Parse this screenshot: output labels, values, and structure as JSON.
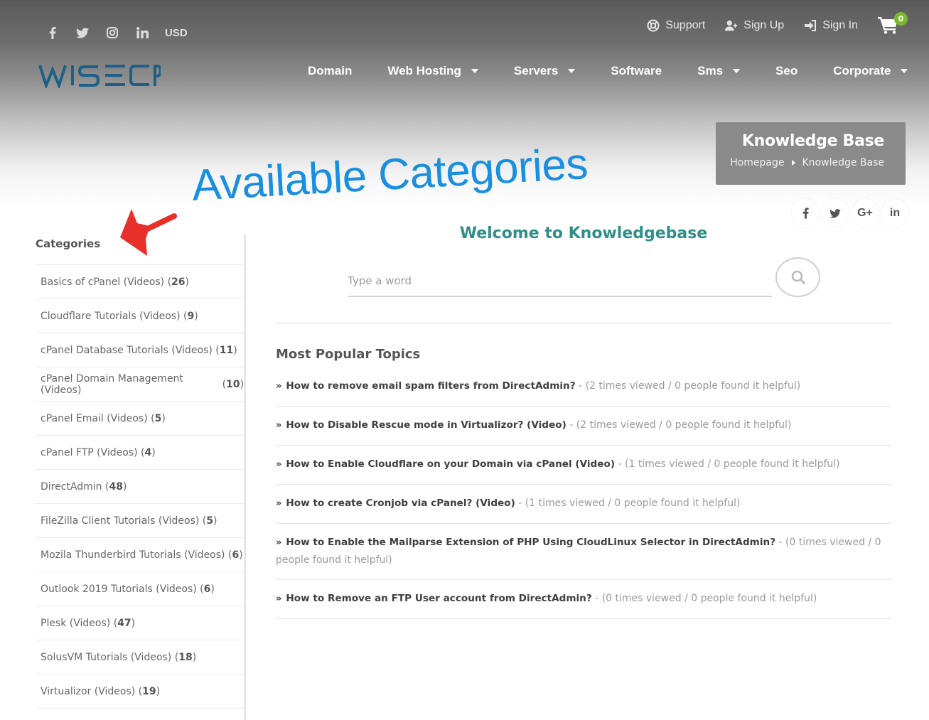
{
  "top": {
    "social_icons": [
      "facebook-icon",
      "twitter-icon",
      "instagram-icon",
      "linkedin-icon"
    ],
    "currency": "USD",
    "user_links": [
      {
        "label": "Support",
        "icon": "lifebuoy-icon"
      },
      {
        "label": "Sign Up",
        "icon": "user-plus-icon"
      },
      {
        "label": "Sign In",
        "icon": "sign-in-icon"
      }
    ],
    "cart_count": "0"
  },
  "logo_text": "WISECP",
  "nav": [
    {
      "label": "Domain",
      "dropdown": false
    },
    {
      "label": "Web Hosting",
      "dropdown": true
    },
    {
      "label": "Servers",
      "dropdown": true
    },
    {
      "label": "Software",
      "dropdown": false
    },
    {
      "label": "Sms",
      "dropdown": true
    },
    {
      "label": "Seo",
      "dropdown": false
    },
    {
      "label": "Corporate",
      "dropdown": true
    }
  ],
  "page_header": {
    "title": "Knowledge Base",
    "breadcrumb": [
      "Homepage",
      "Knowledge Base"
    ]
  },
  "annotation": "Available Categories",
  "share": [
    "f",
    "twitter",
    "G+",
    "in"
  ],
  "sidebar": {
    "heading": "Categories",
    "categories": [
      {
        "name": "Basics of cPanel (Videos)",
        "count": "26"
      },
      {
        "name": "Cloudflare Tutorials (Videos)",
        "count": "9"
      },
      {
        "name": "cPanel Database Tutorials (Videos)",
        "count": "11"
      },
      {
        "name": "cPanel Domain Management (Videos)",
        "count": "10"
      },
      {
        "name": "cPanel Email (Videos)",
        "count": "5"
      },
      {
        "name": "cPanel FTP (Videos)",
        "count": "4"
      },
      {
        "name": "DirectAdmin",
        "count": "48"
      },
      {
        "name": "FileZilla Client Tutorials (Videos)",
        "count": "5"
      },
      {
        "name": "Mozila Thunderbird Tutorials (Videos)",
        "count": "6"
      },
      {
        "name": "Outlook 2019 Tutorials (Videos)",
        "count": "6"
      },
      {
        "name": "Plesk (Videos)",
        "count": "47"
      },
      {
        "name": "SolusVM Tutorials (Videos)",
        "count": "18"
      },
      {
        "name": "Virtualizor (Videos)",
        "count": "19"
      }
    ]
  },
  "main": {
    "welcome": "Welcome to Knowledgebase",
    "search_placeholder": "Type a word",
    "popular_heading": "Most Popular Topics",
    "topics": [
      {
        "title": "How to remove email spam filters from DirectAdmin?",
        "meta": "- (2 times viewed / 0 people found it helpful)"
      },
      {
        "title": "How to Disable Rescue mode in Virtualizor? (Video)",
        "meta": "- (2 times viewed / 0 people found it helpful)"
      },
      {
        "title": "How to Enable Cloudflare on your Domain via cPanel (Video)",
        "meta": "- (1 times viewed / 0 people found it helpful)"
      },
      {
        "title": "How to create Cronjob via cPanel? (Video)",
        "meta": "- (1 times viewed / 0 people found it helpful)"
      },
      {
        "title": "How to Enable the Mailparse Extension of PHP Using CloudLinux Selector in DirectAdmin?",
        "meta": "- (0 times viewed / 0 people found it helpful)"
      },
      {
        "title": "How to Remove an FTP User account from DirectAdmin?",
        "meta": "- (0 times viewed / 0 people found it helpful)"
      }
    ]
  },
  "colors": {
    "accent_teal": "#2f8e89",
    "annotation_blue": "#1a8fe0",
    "annotation_arrow_red": "#e8302a",
    "cart_badge_green": "#7bb82b",
    "logo_blue": "#1d5f86"
  }
}
